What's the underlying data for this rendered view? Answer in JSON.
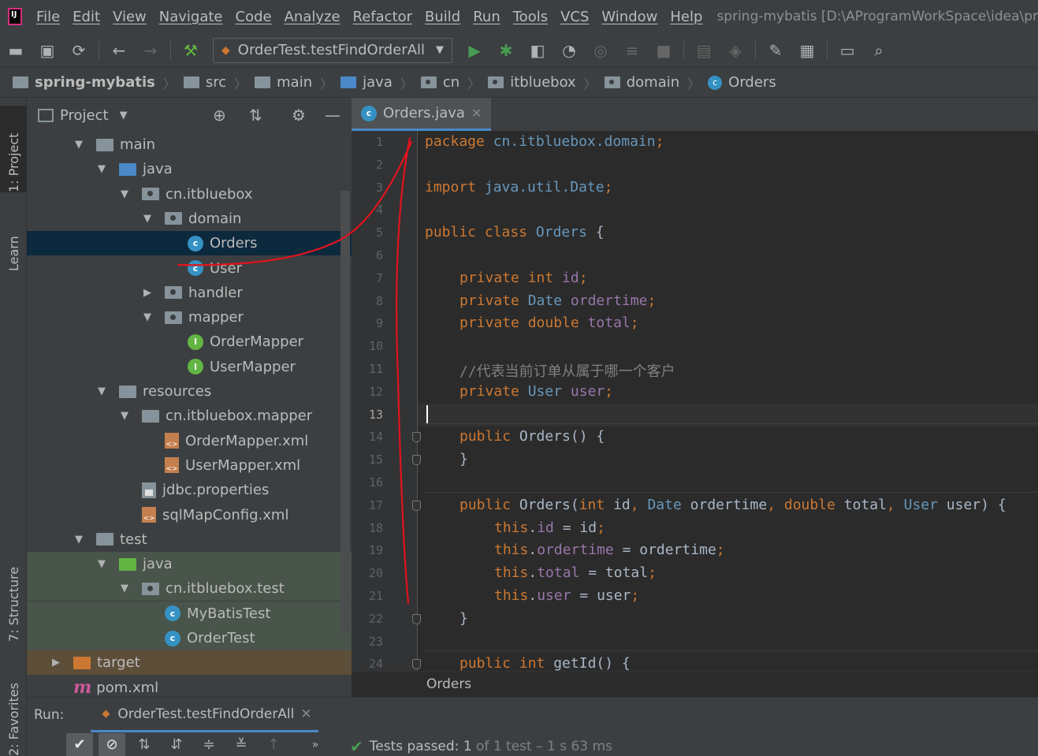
{
  "menu": {
    "items": [
      "File",
      "Edit",
      "View",
      "Navigate",
      "Code",
      "Analyze",
      "Refactor",
      "Build",
      "Run",
      "Tools",
      "VCS",
      "Window",
      "Help"
    ],
    "window_title": "spring-mybatis [D:\\AProgramWorkSpace\\idea\\pr"
  },
  "toolbar": {
    "run_config": "OrderTest.testFindOrderAll",
    "icons": [
      "open-folder-icon",
      "save-icon",
      "sync-icon",
      "back-arrow-icon",
      "forward-arrow-icon",
      "build-hammer-icon",
      "run-icon",
      "debug-bug-icon",
      "coverage-icon",
      "profile-icon",
      "attach-icon",
      "step-icon",
      "stop-icon",
      "device-icon",
      "layers-icon",
      "wrench-icon",
      "project-structure-icon",
      "terminal-icon",
      "search-icon"
    ]
  },
  "breadcrumb": [
    {
      "label": "spring-mybatis",
      "icon": "module-icon",
      "bold": true
    },
    {
      "label": "src",
      "icon": "folder-icon"
    },
    {
      "label": "main",
      "icon": "folder-icon"
    },
    {
      "label": "java",
      "icon": "source-folder-icon"
    },
    {
      "label": "cn",
      "icon": "package-icon"
    },
    {
      "label": "itbluebox",
      "icon": "package-icon"
    },
    {
      "label": "domain",
      "icon": "package-icon"
    },
    {
      "label": "Orders",
      "icon": "class-icon"
    }
  ],
  "left_strip": {
    "tab_project": "1: Project",
    "tab_learn": "Learn",
    "tab_structure": "7: Structure",
    "tab_favorites": "2: Favorites"
  },
  "project": {
    "title": "Project",
    "tree": [
      {
        "label": "main",
        "arrow": "▼",
        "icon": "folder",
        "depth": 0
      },
      {
        "label": "java",
        "arrow": "▼",
        "icon": "folder-blue",
        "depth": 1
      },
      {
        "label": "cn.itbluebox",
        "arrow": "▼",
        "icon": "package",
        "depth": 2
      },
      {
        "label": "domain",
        "arrow": "▼",
        "icon": "package",
        "depth": 3
      },
      {
        "label": "Orders",
        "arrow": "",
        "icon": "class",
        "depth": 4,
        "selected": true
      },
      {
        "label": "User",
        "arrow": "",
        "icon": "class",
        "depth": 4
      },
      {
        "label": "handler",
        "arrow": "▶",
        "icon": "package",
        "depth": 3
      },
      {
        "label": "mapper",
        "arrow": "▼",
        "icon": "package",
        "depth": 3
      },
      {
        "label": "OrderMapper",
        "arrow": "",
        "icon": "interface",
        "depth": 4
      },
      {
        "label": "UserMapper",
        "arrow": "",
        "icon": "interface",
        "depth": 4
      },
      {
        "label": "resources",
        "arrow": "▼",
        "icon": "folder-res",
        "depth": 1
      },
      {
        "label": "cn.itbluebox.mapper",
        "arrow": "▼",
        "icon": "folder",
        "depth": 2
      },
      {
        "label": "OrderMapper.xml",
        "arrow": "",
        "icon": "xml",
        "depth": 3
      },
      {
        "label": "UserMapper.xml",
        "arrow": "",
        "icon": "xml",
        "depth": 3
      },
      {
        "label": "jdbc.properties",
        "arrow": "",
        "icon": "properties",
        "depth": 2
      },
      {
        "label": "sqlMapConfig.xml",
        "arrow": "",
        "icon": "xml",
        "depth": 2
      },
      {
        "label": "test",
        "arrow": "▼",
        "icon": "folder",
        "depth": 0
      },
      {
        "label": "java",
        "arrow": "▼",
        "icon": "folder-green",
        "depth": 1,
        "test": true
      },
      {
        "label": "cn.itbluebox.test",
        "arrow": "▼",
        "icon": "package",
        "depth": 2,
        "test": true
      },
      {
        "label": "MyBatisTest",
        "arrow": "",
        "icon": "test-class",
        "depth": 3,
        "test": true
      },
      {
        "label": "OrderTest",
        "arrow": "",
        "icon": "test-class",
        "depth": 3,
        "test": true
      },
      {
        "label": "target",
        "arrow": "▶",
        "icon": "folder-orange",
        "depth": -1,
        "excluded": true
      },
      {
        "label": "pom.xml",
        "arrow": "",
        "icon": "maven",
        "depth": -1
      }
    ]
  },
  "editor": {
    "tab_label": "Orders.java",
    "current_line": 13,
    "line_numbers": [
      "1",
      "2",
      "3",
      "4",
      "5",
      "6",
      "7",
      "8",
      "9",
      "10",
      "11",
      "12",
      "13",
      "14",
      "15",
      "16",
      "17",
      "18",
      "19",
      "20",
      "21",
      "22",
      "23",
      "24"
    ],
    "code": [
      {
        "indent": 0,
        "tokens": [
          [
            "kw",
            "package "
          ],
          [
            "ty",
            "cn.itbluebox.domain"
          ],
          [
            "kw",
            ";"
          ]
        ]
      },
      {
        "indent": 0,
        "tokens": []
      },
      {
        "indent": 0,
        "tokens": [
          [
            "kw",
            "import "
          ],
          [
            "ty",
            "java.util.Date"
          ],
          [
            "kw",
            ";"
          ]
        ]
      },
      {
        "indent": 0,
        "tokens": []
      },
      {
        "indent": 0,
        "tokens": [
          [
            "kw",
            "public class "
          ],
          [
            "ty",
            "Orders "
          ],
          [
            "pl",
            "{"
          ]
        ]
      },
      {
        "indent": 0,
        "tokens": []
      },
      {
        "indent": 1,
        "tokens": [
          [
            "kw",
            "private int "
          ],
          [
            "fd",
            "id"
          ],
          [
            "kw",
            ";"
          ]
        ]
      },
      {
        "indent": 1,
        "tokens": [
          [
            "kw",
            "private "
          ],
          [
            "ty",
            "Date "
          ],
          [
            "fd",
            "ordertime"
          ],
          [
            "kw",
            ";"
          ]
        ]
      },
      {
        "indent": 1,
        "tokens": [
          [
            "kw",
            "private double "
          ],
          [
            "fd",
            "total"
          ],
          [
            "kw",
            ";"
          ]
        ]
      },
      {
        "indent": 0,
        "tokens": []
      },
      {
        "indent": 1,
        "tokens": [
          [
            "cm",
            "//代表当前订单从属于哪一个客户"
          ]
        ]
      },
      {
        "indent": 1,
        "tokens": [
          [
            "kw",
            "private "
          ],
          [
            "ty",
            "User "
          ],
          [
            "fd",
            "user"
          ],
          [
            "kw",
            ";"
          ]
        ]
      },
      {
        "indent": 0,
        "tokens": []
      },
      {
        "indent": 1,
        "tokens": [
          [
            "kw",
            "public "
          ],
          [
            "pl",
            "Orders() {"
          ]
        ]
      },
      {
        "indent": 1,
        "tokens": [
          [
            "pl",
            "}"
          ]
        ]
      },
      {
        "indent": 0,
        "tokens": []
      },
      {
        "indent": 1,
        "tokens": [
          [
            "kw",
            "public "
          ],
          [
            "pl",
            "Orders("
          ],
          [
            "kw",
            "int "
          ],
          [
            "pl",
            "id"
          ],
          [
            "kw",
            ", "
          ],
          [
            "ty",
            "Date "
          ],
          [
            "pl",
            "ordertime"
          ],
          [
            "kw",
            ", double "
          ],
          [
            "pl",
            "total"
          ],
          [
            "kw",
            ", "
          ],
          [
            "ty",
            "User "
          ],
          [
            "pl",
            "user) {"
          ]
        ]
      },
      {
        "indent": 2,
        "tokens": [
          [
            "kw",
            "this"
          ],
          [
            "pl",
            "."
          ],
          [
            "fd",
            "id "
          ],
          [
            "pl",
            "= id"
          ],
          [
            "kw",
            ";"
          ]
        ]
      },
      {
        "indent": 2,
        "tokens": [
          [
            "kw",
            "this"
          ],
          [
            "pl",
            "."
          ],
          [
            "fd",
            "ordertime "
          ],
          [
            "pl",
            "= ordertime"
          ],
          [
            "kw",
            ";"
          ]
        ]
      },
      {
        "indent": 2,
        "tokens": [
          [
            "kw",
            "this"
          ],
          [
            "pl",
            "."
          ],
          [
            "fd",
            "total "
          ],
          [
            "pl",
            "= total"
          ],
          [
            "kw",
            ";"
          ]
        ]
      },
      {
        "indent": 2,
        "tokens": [
          [
            "kw",
            "this"
          ],
          [
            "pl",
            "."
          ],
          [
            "fd",
            "user "
          ],
          [
            "pl",
            "= user"
          ],
          [
            "kw",
            ";"
          ]
        ]
      },
      {
        "indent": 1,
        "tokens": [
          [
            "pl",
            "}"
          ]
        ]
      },
      {
        "indent": 0,
        "tokens": []
      },
      {
        "indent": 1,
        "tokens": [
          [
            "kw",
            "public int "
          ],
          [
            "pl",
            "getId() {"
          ]
        ]
      }
    ],
    "footer_breadcrumb": "Orders"
  },
  "run": {
    "label": "Run:",
    "tab_label": "OrderTest.testFindOrderAll",
    "status_prefix": "Tests passed:",
    "passed_count": "1",
    "status_of": "of 1 test – 1 s 63 ms",
    "buttons": [
      "show-passed-icon",
      "show-ignored-icon",
      "sort-alpha-icon",
      "sort-duration-icon",
      "expand-all-icon",
      "collapse-all-icon",
      "previous-failed-icon"
    ]
  },
  "colors": {
    "keyword": "#cc7832",
    "type": "#6897bb",
    "field": "#9876aa",
    "comment": "#808080",
    "plain": "#a9b7c6",
    "annotation_stroke": "#e0141e"
  }
}
